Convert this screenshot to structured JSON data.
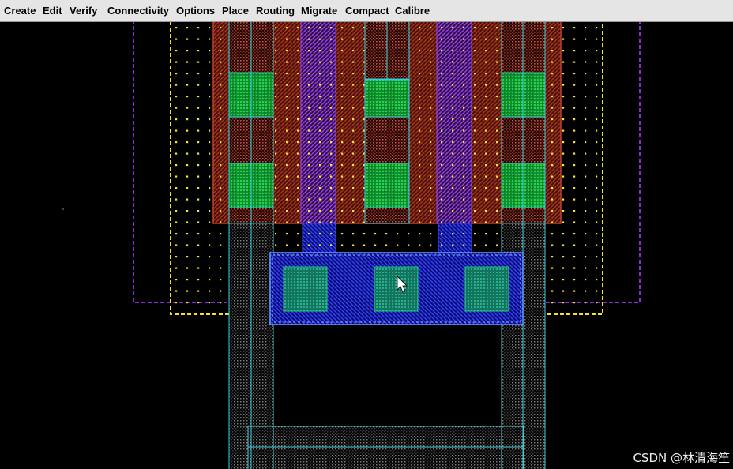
{
  "menubar": {
    "items": [
      {
        "label": "Create"
      },
      {
        "label": "Edit"
      },
      {
        "label": "Verify"
      },
      {
        "label": "Connectivity"
      },
      {
        "label": "Options"
      },
      {
        "label": "Place"
      },
      {
        "label": "Routing"
      },
      {
        "label": "Migrate"
      },
      {
        "label": "Compact"
      },
      {
        "label": "Calibre"
      }
    ]
  },
  "watermark": {
    "text": "CSDN @林清海笙"
  },
  "theme": {
    "menubar_bg": "#e5e5e5",
    "menubar_text": "#000000",
    "canvas_bg": "#000000",
    "watermark_text": "#eeeeee"
  }
}
